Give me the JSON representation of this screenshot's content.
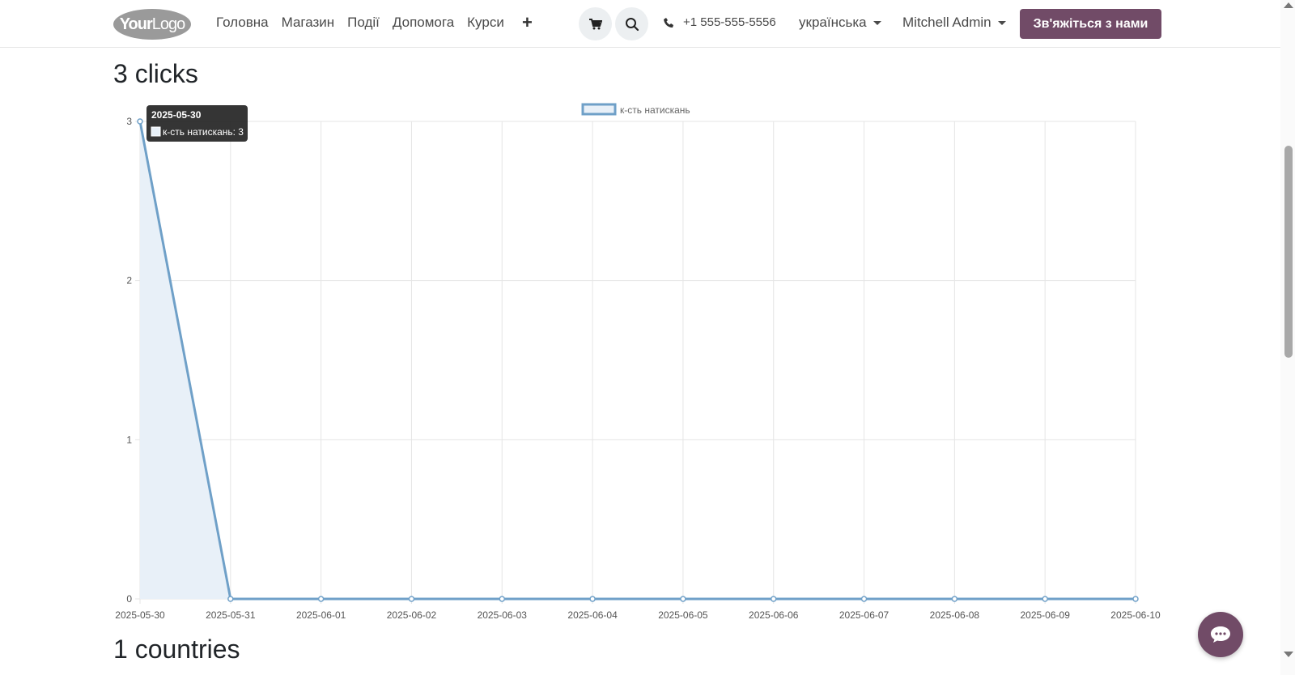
{
  "header": {
    "logo_text_bold": "Your",
    "logo_text_light": "Logo",
    "nav": [
      "Головна",
      "Магазин",
      "Події",
      "Допомога",
      "Курси"
    ],
    "plus_label": "+",
    "phone": "+1 555-555-5556",
    "language": "українська",
    "user": "Mitchell Admin",
    "contact_button": "Зв'яжіться з нами"
  },
  "clicks_title": "3 clicks",
  "countries_title": "1 countries",
  "colors": {
    "brand": "#714b67",
    "line": "#6fa0c8",
    "fill": "#e8f0f8"
  },
  "chart_data": {
    "type": "line",
    "x": [
      "2025-05-30",
      "2025-05-31",
      "2025-06-01",
      "2025-06-02",
      "2025-06-03",
      "2025-06-04",
      "2025-06-05",
      "2025-06-06",
      "2025-06-07",
      "2025-06-08",
      "2025-06-09",
      "2025-06-10"
    ],
    "series": [
      {
        "name": "к-сть натискань",
        "values": [
          3,
          0,
          0,
          0,
          0,
          0,
          0,
          0,
          0,
          0,
          0,
          0
        ]
      }
    ],
    "yticks": [
      0,
      1,
      2,
      3
    ],
    "ylim": [
      0,
      3
    ],
    "legend": "top-center",
    "grid": true,
    "tooltip": {
      "title": "2025-05-30",
      "text": "к-сть натискань: 3"
    }
  }
}
